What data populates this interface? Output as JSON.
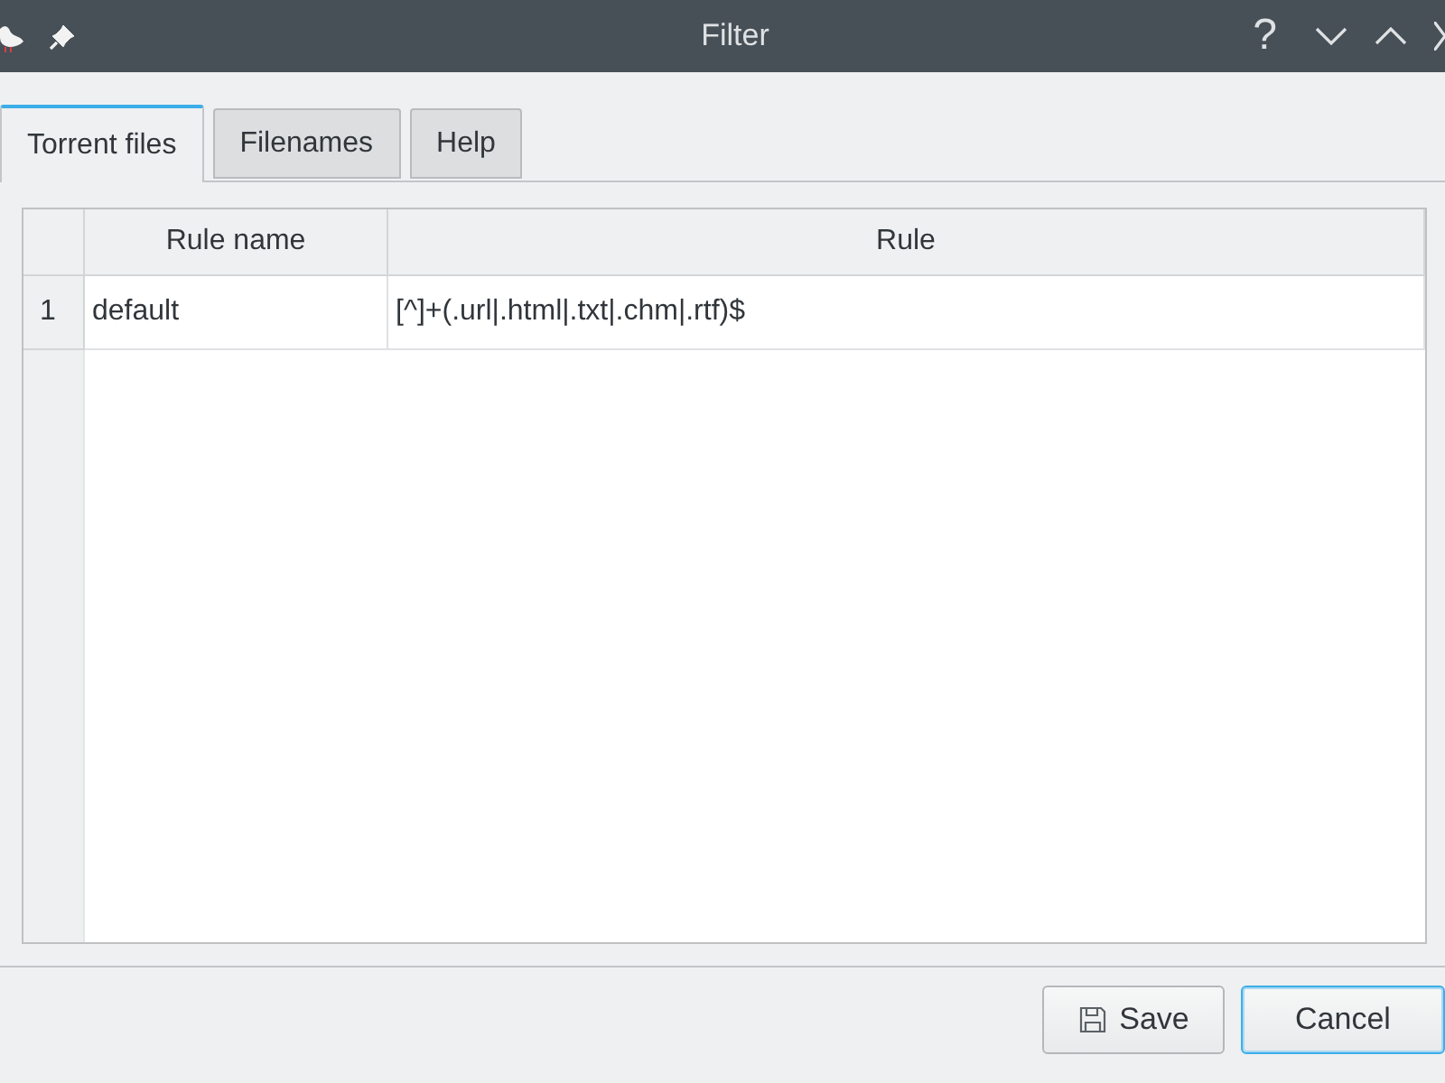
{
  "window": {
    "title": "Filter",
    "help": "?"
  },
  "tabs": [
    {
      "label": "Torrent files",
      "selected": true
    },
    {
      "label": "Filenames",
      "selected": false
    },
    {
      "label": "Help",
      "selected": false
    }
  ],
  "table": {
    "columns": [
      "Rule name",
      "Rule"
    ],
    "rows": [
      {
        "number": "1",
        "cells": [
          "default",
          "[^]+(.url|.html|.txt|.chm|.rtf)$"
        ]
      }
    ]
  },
  "buttons": [
    {
      "label": "Save",
      "kind": "save",
      "focused": false
    },
    {
      "label": "Cancel",
      "kind": "plain",
      "focused": true
    }
  ]
}
